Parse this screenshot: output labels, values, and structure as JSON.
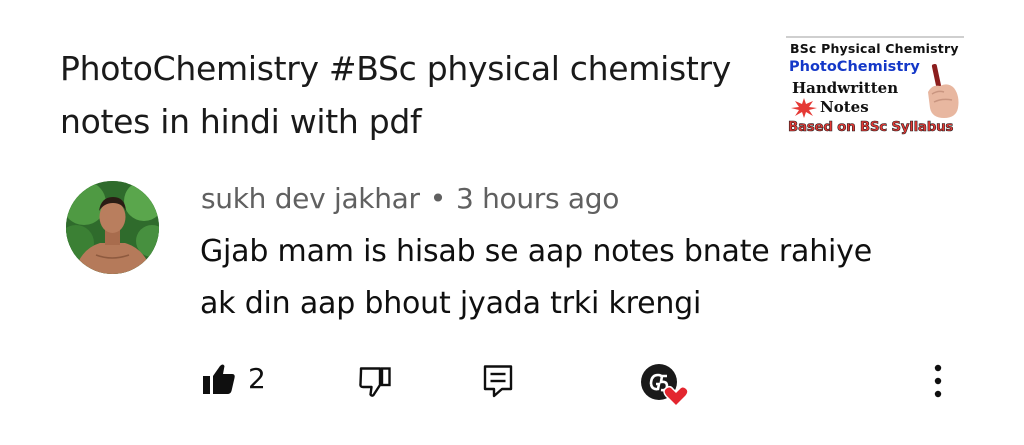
{
  "video": {
    "title": "PhotoChemistry #BSc physical chemistry notes in hindi with pdf",
    "thumbnail": {
      "line1": "BSc Physical Chemistry",
      "line2": "PhotoChemistry",
      "line3": "Handwritten",
      "line4": "Notes",
      "line5": "Based on BSc Syllabus"
    }
  },
  "comment": {
    "author": "sukh dev jakhar",
    "separator": "•",
    "time": "3 hours ago",
    "text": "Gjab mam is hisab se aap notes bnate rahiye ak din aap bhout jyada trki krengi"
  },
  "actions": {
    "like_count": "2",
    "icons": [
      "thumbs-up-icon",
      "thumbs-down-icon",
      "reply-icon",
      "creator-heart-badge",
      "more-vert-icon"
    ]
  },
  "colors": {
    "text": "#0f0f0f",
    "meta": "#606060",
    "heart": "#e3262f",
    "thumb_blue": "#1438c8"
  }
}
